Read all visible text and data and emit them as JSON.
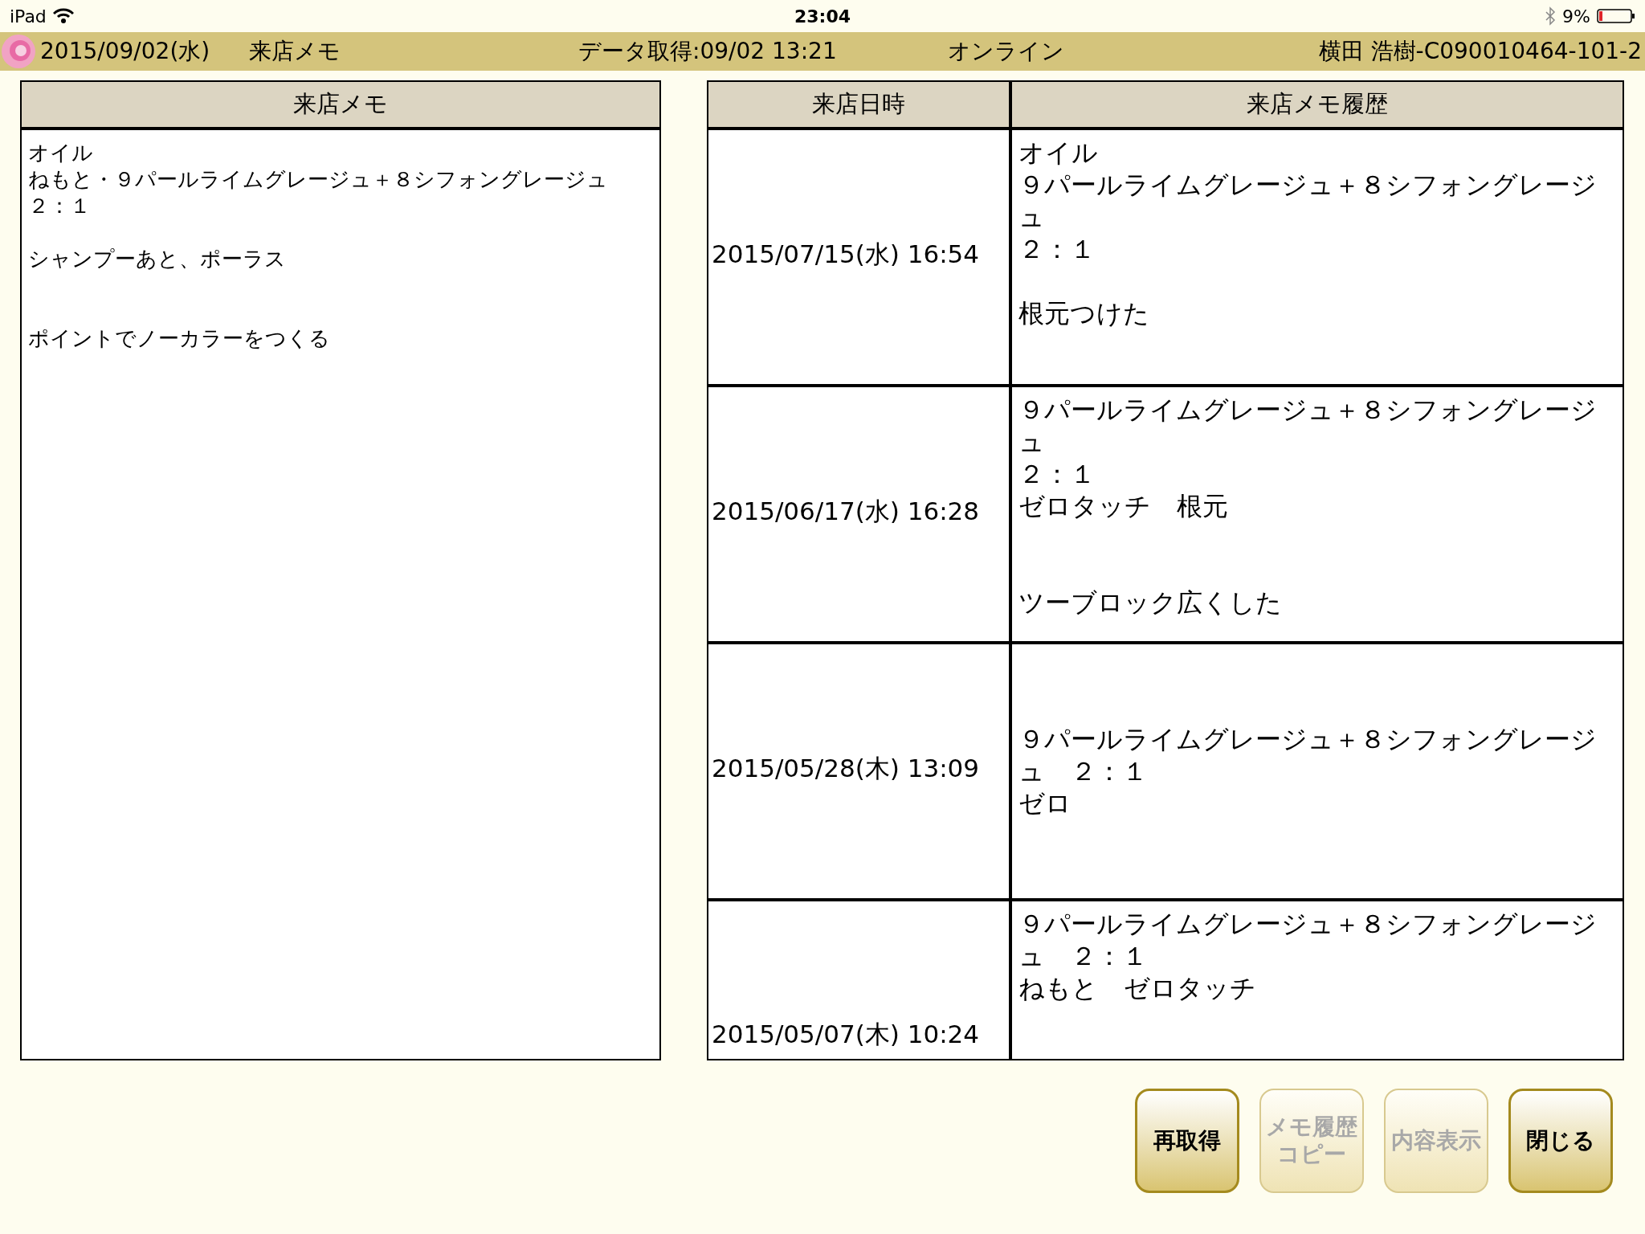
{
  "status_bar": {
    "device": "iPad",
    "time": "23:04",
    "battery": "9%"
  },
  "header": {
    "date": "2015/09/02(水)",
    "title": "来店メモ",
    "data_fetched": "データ取得:09/02 13:21",
    "connection": "オンライン",
    "user": "横田 浩樹-C090010464-101-2"
  },
  "memo": {
    "heading": "来店メモ",
    "lines": [
      {
        "kind": "text",
        "text": "オイル"
      },
      {
        "kind": "text",
        "text": "ねもと・９パールライムグレージュ＋８シフォングレージュ"
      },
      {
        "kind": "text",
        "text": "２：１"
      },
      {
        "kind": "blank"
      },
      {
        "kind": "text",
        "text": "シャンプーあと、ポーラス"
      },
      {
        "kind": "blank"
      },
      {
        "kind": "blank"
      },
      {
        "kind": "text",
        "text": "ポイントでノーカラーをつくる"
      }
    ]
  },
  "history": {
    "columns": [
      "来店日時",
      "来店メモ履歴"
    ],
    "rows": [
      {
        "datetime": "2015/07/15(水) 16:54",
        "lines": [
          {
            "kind": "text",
            "text": "オイル"
          },
          {
            "kind": "text",
            "text": "９パールライムグレージュ＋８シフォングレージュ"
          },
          {
            "kind": "text",
            "text": "２：１"
          },
          {
            "kind": "blank"
          },
          {
            "kind": "text",
            "text": "根元つけた"
          }
        ]
      },
      {
        "datetime": "2015/06/17(水) 16:28",
        "lines": [
          {
            "kind": "text",
            "text": "９パールライムグレージュ＋８シフォングレージュ"
          },
          {
            "kind": "text",
            "text": "２：１"
          },
          {
            "kind": "text",
            "text": "ゼロタッチ　根元"
          },
          {
            "kind": "blank"
          },
          {
            "kind": "blank"
          },
          {
            "kind": "text",
            "text": "ツーブロック広くした"
          }
        ]
      },
      {
        "datetime": "2015/05/28(木) 13:09",
        "lines": [
          {
            "kind": "text",
            "text": "９パールライムグレージュ＋８シフォングレージュ　２：１"
          },
          {
            "kind": "text",
            "text": "ゼロ"
          }
        ]
      },
      {
        "datetime": "2015/05/07(木) 10:24",
        "lines": [
          {
            "kind": "text",
            "text": "９パールライムグレージュ＋８シフォングレージュ　２：１"
          },
          {
            "kind": "text",
            "text": "ねもと　ゼロタッチ"
          }
        ]
      }
    ]
  },
  "buttons": [
    {
      "label": "再取得",
      "disabled": false
    },
    {
      "label": "メモ履歴コピー",
      "disabled": true
    },
    {
      "label": "内容表示",
      "disabled": true
    },
    {
      "label": "閉じる",
      "disabled": false
    }
  ]
}
